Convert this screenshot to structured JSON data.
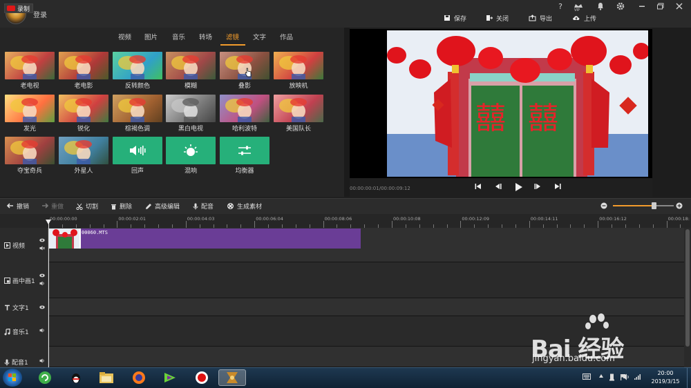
{
  "app": {
    "login_label": "登录",
    "top_icons": [
      "help-icon",
      "vip-icon",
      "bell-icon",
      "gear-icon",
      "minimize-icon",
      "maximize-icon",
      "close-icon"
    ],
    "help_glyph": "?",
    "vip_label": "VIP",
    "header_buttons": [
      {
        "label": "保存",
        "icon": "save-icon"
      },
      {
        "label": "关闭",
        "icon": "exit-icon"
      },
      {
        "label": "导出",
        "icon": "export-icon"
      },
      {
        "label": "上传",
        "icon": "upload-icon"
      }
    ]
  },
  "library": {
    "record_label": "录制",
    "tabs": [
      "视频",
      "图片",
      "音乐",
      "转场",
      "滤镜",
      "文字",
      "作品"
    ],
    "active_tab": "滤镜",
    "effects": [
      {
        "label": "老电视"
      },
      {
        "label": "老电影"
      },
      {
        "label": "反转颜色"
      },
      {
        "label": "模糊"
      },
      {
        "label": "叠影"
      },
      {
        "label": "放映机"
      },
      {
        "label": "发光"
      },
      {
        "label": "锐化"
      },
      {
        "label": "棕褐色调"
      },
      {
        "label": "黑白电视"
      },
      {
        "label": "哈利波特"
      },
      {
        "label": "美国队长"
      },
      {
        "label": "夺宝奇兵"
      },
      {
        "label": "外星人"
      },
      {
        "label": "回声"
      },
      {
        "label": "混响"
      },
      {
        "label": "均衡器"
      }
    ]
  },
  "preview": {
    "timecode": "00:00:00:01/00:00:09:12",
    "controls": [
      "skip-start-icon",
      "step-back-icon",
      "play-icon",
      "step-forward-icon",
      "skip-end-icon"
    ]
  },
  "edit_toolbar": {
    "buttons": [
      {
        "label": "撤销",
        "enabled": true
      },
      {
        "label": "重做",
        "enabled": false
      },
      {
        "label": "切割",
        "enabled": true
      },
      {
        "label": "删除",
        "enabled": true
      },
      {
        "label": "高级编辑",
        "enabled": true
      },
      {
        "label": "配音",
        "enabled": true
      },
      {
        "label": "生成素材",
        "enabled": true
      }
    ]
  },
  "timeline": {
    "ruler_labels": [
      "00:00:00:00",
      "00:00:02:01",
      "00:00:04:03",
      "00:00:06:04",
      "00:00:08:06",
      "00:00:10:08",
      "00:00:12:09",
      "00:00:14:11",
      "00:00:16:12",
      "00:00:18:"
    ],
    "tracks": [
      "视频",
      "画中画1",
      "文字1",
      "音乐1",
      "配音1"
    ],
    "clip_name": "00060.MTS"
  },
  "taskbar": {
    "time": "20:00",
    "date": "2019/3/15"
  },
  "watermark": {
    "brand": "Bai 经验",
    "url": "jingyan.baidu.com"
  },
  "colors": {
    "accent": "#f39c2c",
    "record_red": "#e01818",
    "clip_purple": "#6a3d96",
    "audio_fx_green": "#26b07a"
  }
}
